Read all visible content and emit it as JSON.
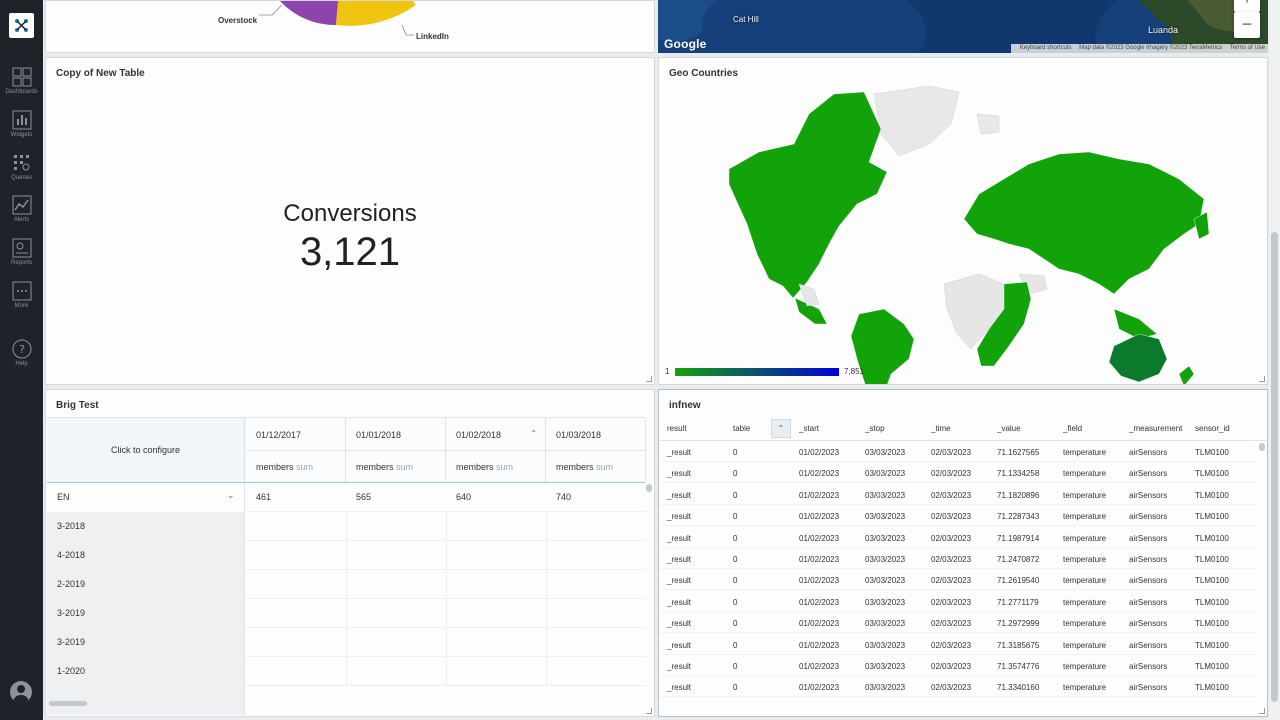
{
  "pie": {
    "labels": [
      "Overstock",
      "LinkedIn"
    ],
    "colors": {
      "purple": "#8e44ad",
      "yellow": "#f1c40f"
    }
  },
  "map": {
    "zoom_in": "+",
    "zoom_out": "−",
    "google": "Google",
    "place_cat_hill": "Cat Hill",
    "place_luanda": "Luanda",
    "footer": [
      "Keyboard shortcuts",
      "Map data ©2023 Google Imagery ©2023 TerraMetrics",
      "Terms of Use"
    ]
  },
  "conversions": {
    "title": "Copy of New Table",
    "label": "Conversions",
    "value": "3,121"
  },
  "geo": {
    "title": "Geo Countries",
    "legend_min": "1",
    "legend_max": "7,851",
    "colors": {
      "filled": "#12a30b",
      "dark": "#0b7a2a",
      "empty": "#e6e6e6"
    }
  },
  "brig": {
    "title": "Brig Test",
    "configure": "Click to configure",
    "columns": [
      "01/12/2017",
      "01/01/2018",
      "01/02/2018",
      "01/03/2018"
    ],
    "measure": "members",
    "agg": "sum",
    "rows": [
      {
        "label": "EN",
        "values": [
          "461",
          "565",
          "640",
          "740"
        ]
      },
      {
        "label": "3-2018",
        "values": [
          "",
          "",
          "",
          ""
        ]
      },
      {
        "label": "4-2018",
        "values": [
          "",
          "",
          "",
          ""
        ]
      },
      {
        "label": "2-2019",
        "values": [
          "",
          "",
          "",
          ""
        ]
      },
      {
        "label": "3-2019",
        "values": [
          "",
          "",
          "",
          ""
        ]
      },
      {
        "label": "3-2019",
        "values": [
          "",
          "",
          "",
          ""
        ]
      },
      {
        "label": "1-2020",
        "values": [
          "",
          "",
          "",
          ""
        ]
      }
    ]
  },
  "inf": {
    "title": "infnew",
    "columns": [
      "result",
      "table",
      "_start",
      "_stop",
      "_time",
      "_value",
      "_field",
      "_measurement",
      "sensor_id"
    ],
    "rows": [
      [
        "_result",
        "0",
        "01/02/2023",
        "03/03/2023",
        "02/03/2023",
        "71.1627565",
        "temperature",
        "airSensors",
        "TLM0100"
      ],
      [
        "_result",
        "0",
        "01/02/2023",
        "03/03/2023",
        "02/03/2023",
        "71.1334258",
        "temperature",
        "airSensors",
        "TLM0100"
      ],
      [
        "_result",
        "0",
        "01/02/2023",
        "03/03/2023",
        "02/03/2023",
        "71.1820896",
        "temperature",
        "airSensors",
        "TLM0100"
      ],
      [
        "_result",
        "0",
        "01/02/2023",
        "03/03/2023",
        "02/03/2023",
        "71.2287343",
        "temperature",
        "airSensors",
        "TLM0100"
      ],
      [
        "_result",
        "0",
        "01/02/2023",
        "03/03/2023",
        "02/03/2023",
        "71.1987914",
        "temperature",
        "airSensors",
        "TLM0100"
      ],
      [
        "_result",
        "0",
        "01/02/2023",
        "03/03/2023",
        "02/03/2023",
        "71.2470872",
        "temperature",
        "airSensors",
        "TLM0100"
      ],
      [
        "_result",
        "0",
        "01/02/2023",
        "03/03/2023",
        "02/03/2023",
        "71.2619540",
        "temperature",
        "airSensors",
        "TLM0100"
      ],
      [
        "_result",
        "0",
        "01/02/2023",
        "03/03/2023",
        "02/03/2023",
        "71.2771179",
        "temperature",
        "airSensors",
        "TLM0100"
      ],
      [
        "_result",
        "0",
        "01/02/2023",
        "03/03/2023",
        "02/03/2023",
        "71.2972999",
        "temperature",
        "airSensors",
        "TLM0100"
      ],
      [
        "_result",
        "0",
        "01/02/2023",
        "03/03/2023",
        "02/03/2023",
        "71.3185675",
        "temperature",
        "airSensors",
        "TLM0100"
      ],
      [
        "_result",
        "0",
        "01/02/2023",
        "03/03/2023",
        "02/03/2023",
        "71.3574776",
        "temperature",
        "airSensors",
        "TLM0100"
      ],
      [
        "_result",
        "0",
        "01/02/2023",
        "03/03/2023",
        "02/03/2023",
        "71.3340160",
        "temperature",
        "airSensors",
        "TLM0100"
      ]
    ]
  },
  "sidebar": {
    "items": [
      {
        "label": "Dashboards",
        "icon": "dashboards-icon"
      },
      {
        "label": "Widgets",
        "icon": "widgets-icon"
      },
      {
        "label": "Queries",
        "icon": "queries-icon"
      },
      {
        "label": "Alerts",
        "icon": "alerts-icon"
      },
      {
        "label": "Reports",
        "icon": "reports-icon"
      },
      {
        "label": "More",
        "icon": "more-icon"
      },
      {
        "label": "Help",
        "icon": "help-icon"
      }
    ]
  }
}
